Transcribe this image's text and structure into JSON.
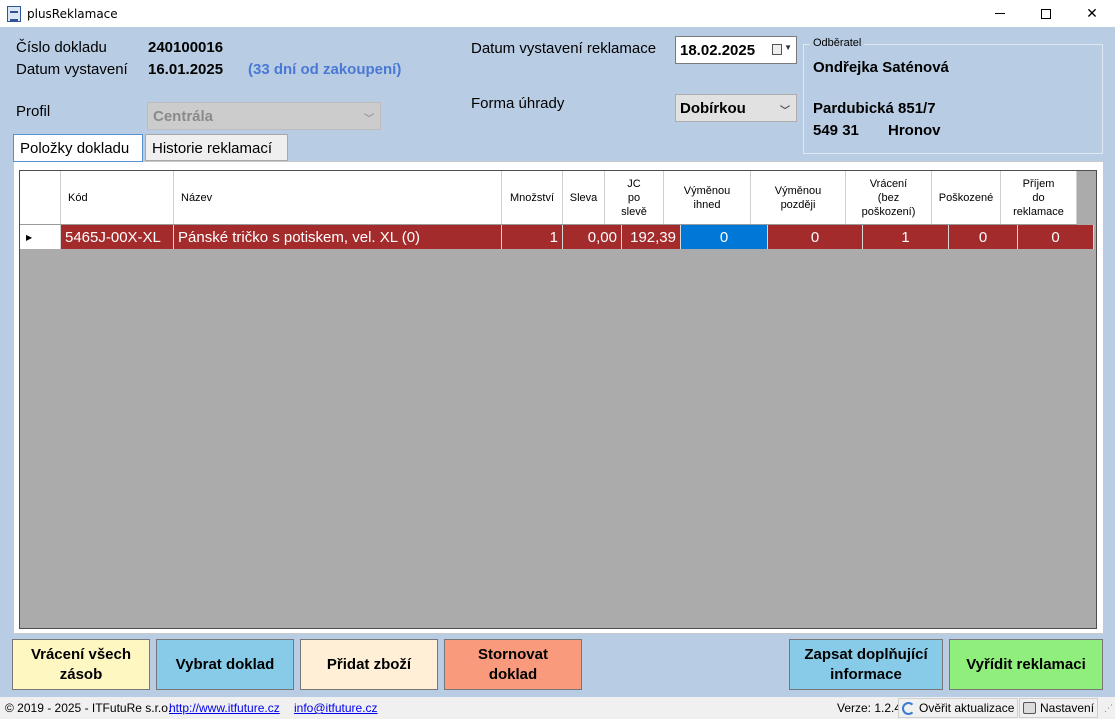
{
  "window": {
    "title": "plusReklamace"
  },
  "document": {
    "number_label": "Číslo dokladu",
    "number": "240100016",
    "issued_label": "Datum vystavení",
    "issued": "16.01.2025",
    "days_since": "(33 dní od zakoupení)"
  },
  "profile": {
    "label": "Profil",
    "value": "Centrála"
  },
  "complaint": {
    "date_label": "Datum vystavení reklamace",
    "date": "18.02.2025",
    "payment_label": "Forma úhrady",
    "payment": "Dobírkou"
  },
  "customer": {
    "legend": "Odběratel",
    "name": "Ondřejka Saténová",
    "street": "Pardubická 851/7",
    "zip": "549 31",
    "city": "Hronov"
  },
  "tabs": [
    {
      "label": "Položky dokladu",
      "active": true
    },
    {
      "label": "Historie reklamací",
      "active": false
    }
  ],
  "grid": {
    "columns": [
      {
        "key": "kod",
        "label": "Kód"
      },
      {
        "key": "nazev",
        "label": "Název"
      },
      {
        "key": "mnozstvi",
        "label": "Množství"
      },
      {
        "key": "sleva",
        "label": "Sleva"
      },
      {
        "key": "jc",
        "label": "JC\npo\nslevě"
      },
      {
        "key": "vymenou_ihned",
        "label": "Výměnou\nihned"
      },
      {
        "key": "vymenou_pozdeji",
        "label": "Výměnou\npozději"
      },
      {
        "key": "vraceni",
        "label": "Vrácení\n(bez\npoškození)"
      },
      {
        "key": "poskozene",
        "label": "Poškozené"
      },
      {
        "key": "prijem",
        "label": "Příjem\ndo\nreklamace"
      }
    ],
    "rows": [
      {
        "kod": "5465J-00X-XL",
        "nazev": "Pánské tričko s potiskem, vel. XL (0)",
        "mnozstvi": "1",
        "sleva": "0,00",
        "jc": "192,39",
        "vymenou_ihned": "0",
        "vymenou_pozdeji": "0",
        "vraceni": "1",
        "poskozene": "0",
        "prijem": "0"
      }
    ]
  },
  "buttons": {
    "vraceni": "Vrácení všech\nzásob",
    "vybrat": "Vybrat doklad",
    "pridat": "Přidat zboží",
    "storno": "Stornovat\ndoklad",
    "zapsat": "Zapsat doplňující\ninformace",
    "vyridit": "Vyřídit reklamaci"
  },
  "statusbar": {
    "copyright": "© 2019 - 2025 - ITFutuRe s.r.o.",
    "web": "http://www.itfuture.cz",
    "email": "info@itfuture.cz",
    "version": "Verze: 1.2.4",
    "update": "Ověřit aktualizace",
    "settings": "Nastavení"
  },
  "colors": {
    "background": "#b8cde4",
    "row_highlight": "#a32b2b",
    "selected_cell": "#0078d7",
    "days_text": "#4a78d4"
  }
}
